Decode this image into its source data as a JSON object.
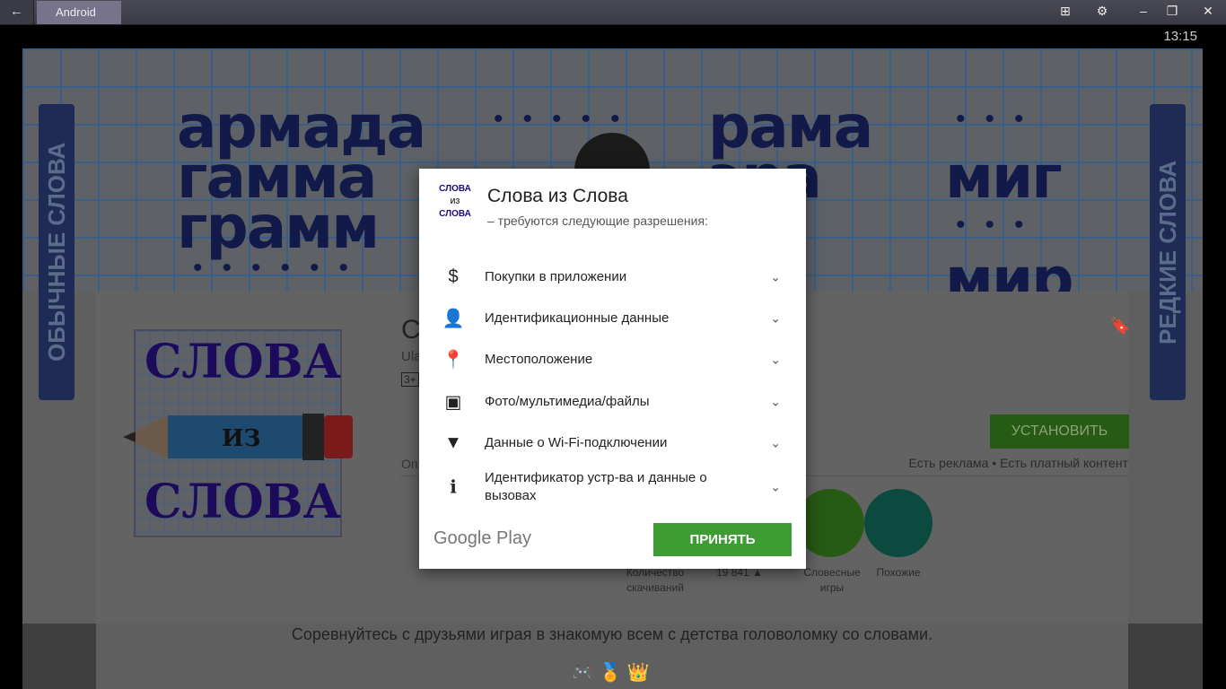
{
  "window": {
    "tab": "Android",
    "back_icon": "arrow-left-icon",
    "clock": "13:15"
  },
  "banner": {
    "left_label": "ОБЫЧНЫЕ СЛОВА",
    "right_label": "РЕДКИЕ СЛОВА",
    "words_left": [
      "армада",
      "гамма",
      "грамм"
    ],
    "words_mid": [
      "рама",
      "эра"
    ],
    "words_right": [
      "миг",
      "мир"
    ]
  },
  "app": {
    "title_partial": "С",
    "dev_partial": "Ula",
    "rating": "3+",
    "install": "УСТАНОВИТЬ",
    "ads": "Есть реклама • Есть платный контент",
    "desc_partial": "Оп",
    "icon_text": [
      "СЛОВА",
      "ИЗ",
      "СЛОВА"
    ],
    "stats": [
      {
        "label": "Количество скачиваний"
      },
      {
        "label": "19 841 ▲"
      },
      {
        "label": "Словесные игры"
      },
      {
        "label": "Похожие"
      }
    ],
    "description": "Соревнуйтесь с друзьями играя в знакомую всем с детства головоломку со словами."
  },
  "dialog": {
    "title": "Слова из Слова",
    "subtitle": "– требуются следующие разрешения:",
    "permissions": [
      {
        "icon": "dollar-icon",
        "label": "Покупки в приложении"
      },
      {
        "icon": "person-icon",
        "label": "Идентификационные данные"
      },
      {
        "icon": "location-pin-icon",
        "label": "Местоположение"
      },
      {
        "icon": "photo-media-icon",
        "label": "Фото/мультимедиа/файлы"
      },
      {
        "icon": "wifi-icon",
        "label": "Данные о Wi-Fi-подключении"
      },
      {
        "icon": "phone-info-icon",
        "label": "Идентификатор устр-ва и данные о вызовах"
      }
    ],
    "brand": "Google Play",
    "accept": "ПРИНЯТЬ",
    "accent": "#3d9c32"
  }
}
